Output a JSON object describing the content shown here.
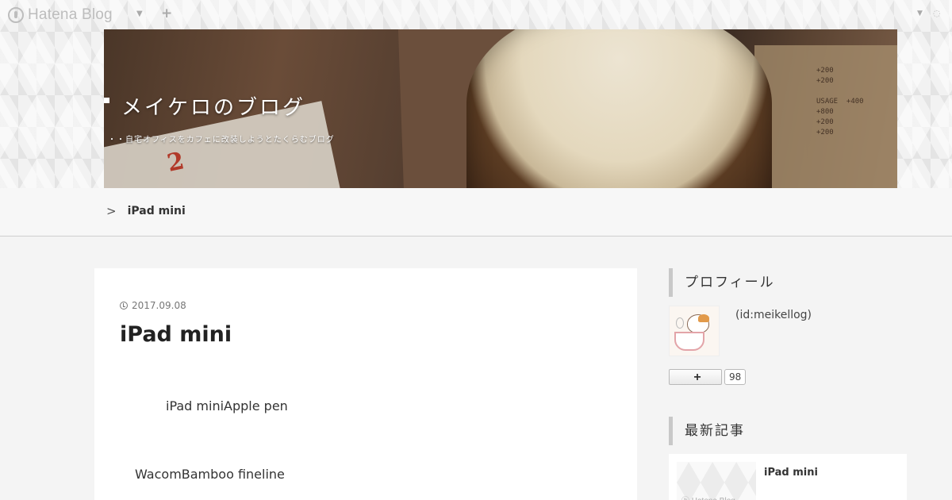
{
  "global_header": {
    "logo_text": "Hatena Blog",
    "caret_icon": "chevron-down-icon",
    "plus_icon": "plus-icon",
    "right_caret_icon": "chevron-down-icon"
  },
  "blog": {
    "title": "メイケロのブログ",
    "description": "・・自宅オフィスをカフェに改装しようとたくらむブログ",
    "menu_text": "+200\n+200\n\nUSAGE  +400\n+800\n+200\n+200"
  },
  "breadcrumb": {
    "separator": ">",
    "items": [
      {
        "label": "iPad mini"
      }
    ]
  },
  "entry": {
    "date": "2017.09.08",
    "title": "iPad mini",
    "title_suffix": "",
    "paragraph_1": "iPad miniApple pen",
    "paragraph_2": "WacomBamboo fineline"
  },
  "sidebar": {
    "about_heading": "プロフィール",
    "profile_id": "(id:meikellog)",
    "follow_label": "+",
    "follower_count": "98",
    "recent_heading": "最新記事",
    "recent_items": [
      {
        "title": "iPad mini",
        "thumb_logo": "ⓗ Hatena Blog"
      }
    ]
  },
  "colors": {
    "page_background": "#f4f4f4",
    "card_background": "#ffffff",
    "heading_border": "#c8c8c8",
    "title_text": "#222222"
  }
}
